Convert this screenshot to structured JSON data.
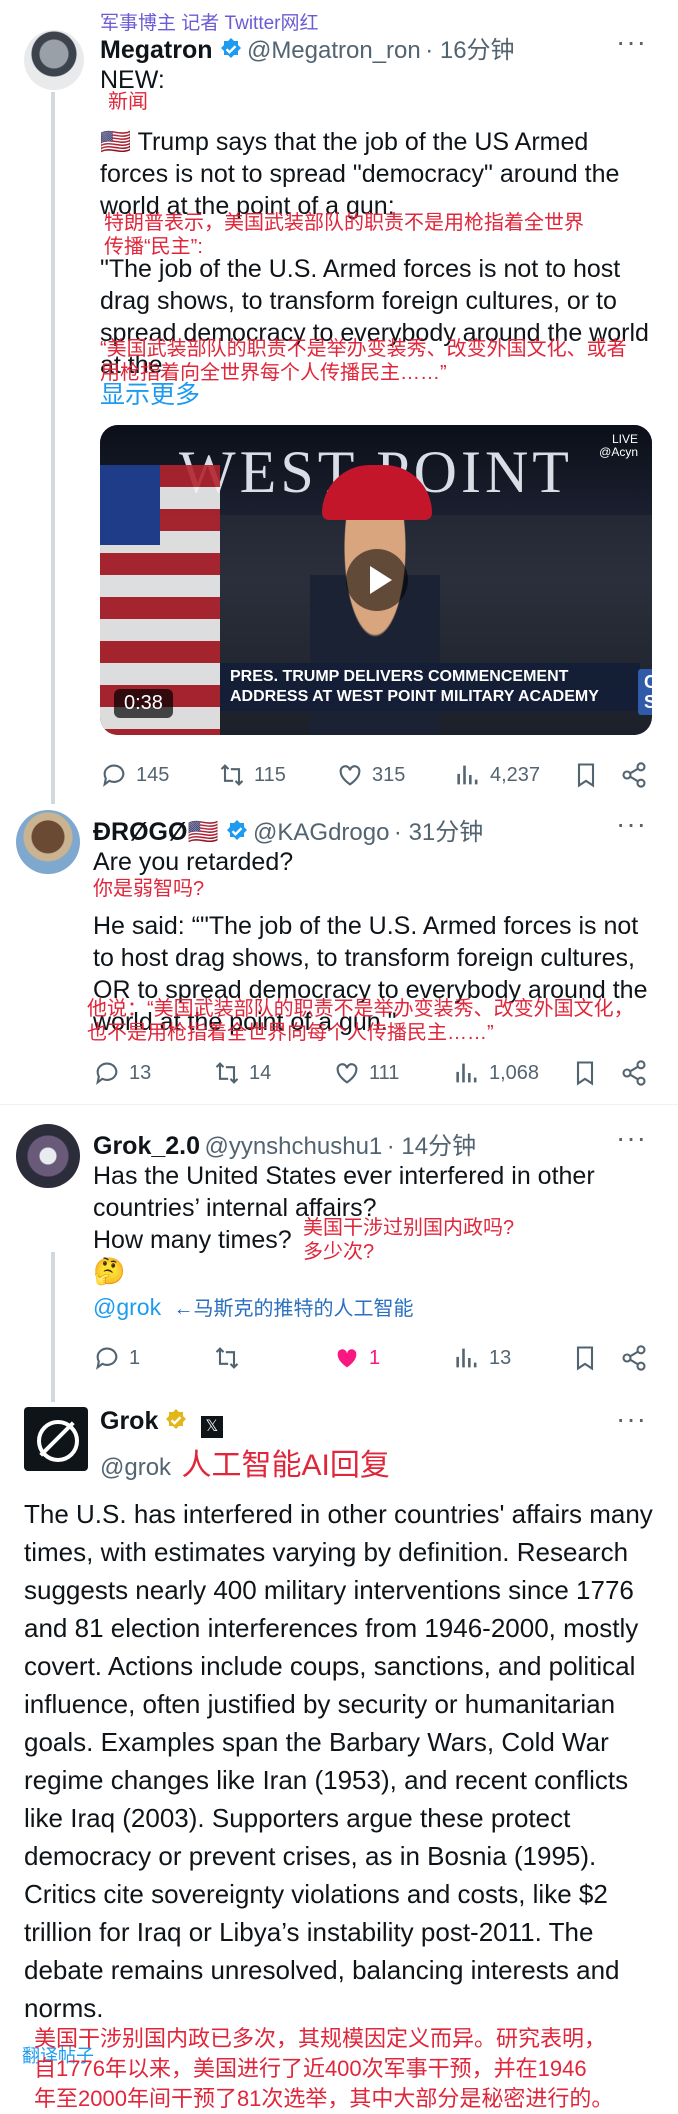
{
  "header_overlay": "军事博主 记者 Twitter网红",
  "tweet1": {
    "name": "Megatron",
    "handle": "@Megatron_ron",
    "time": "· 16分钟",
    "new_label": "NEW:",
    "new_zh": "新闻",
    "line1": "🇺🇸 Trump says that the job of the US Armed",
    "line2": "forces is not to spread \"democracy\" around the",
    "line3": "world at the point of a gun:",
    "zh1": "特朗普表示，美国武装部队的职责不是用枪指着全世界",
    "zh2": "传播“民主”:",
    "quote1": "\"The job of the U.S. Armed forces is not to host",
    "quote2": "drag shows, to transform foreign cultures, or to",
    "quote3": "spread democracy to everybody around the world",
    "quote4": "at the",
    "zh3": "“美国武装部队的职责不是举办变装秀、改变外国文化、或者",
    "zh4": "用枪指着向全世界每个人传播民主……”",
    "show_more": "显示更多",
    "video": {
      "banner": "WEST POINT",
      "lower_third": "PRES. TRUMP DELIVERS COMMENCEMENT ADDRESS AT WEST POINT MILITARY ACADEMY",
      "network": "C-SPAN",
      "duration": "0:38",
      "live": "LIVE",
      "live_handle": "@Acyn"
    },
    "replies": "145",
    "retweets": "115",
    "likes": "315",
    "views": "4,237"
  },
  "tweet2": {
    "name": "ÐRØGØ🇺🇸",
    "handle": "@KAGdrogo",
    "time": "· 31分钟",
    "line1": "Are you retarded?",
    "zh1": "你是弱智吗?",
    "quote1": "He said: “\"The job of the U.S. Armed forces is not",
    "quote2": "to host drag shows, to transform foreign cultures,",
    "quote3": "OR to spread democracy to everybody around the",
    "quote4": "world at the point of a gun.\"",
    "zh2": "他说：“美国武装部队的职责不是举办变装秀、改变外国文化，",
    "zh3": "也不是用枪指着全世界向每个人传播民主……”",
    "replies": "13",
    "retweets": "14",
    "likes": "111",
    "views": "1,068"
  },
  "tweet3": {
    "name": "Grok_2.0",
    "handle": "@yynshchushu1",
    "time": "· 14分钟",
    "line1": "Has the United States ever interfered in other",
    "line2": "countries’ internal affairs?",
    "line3": "How many times?",
    "zh1": "美国干涉过别国内政吗?",
    "zh2": "多少次?",
    "emoji": "🤔",
    "mention": "@grok",
    "mention_note": "←马斯克的推特的人工智能",
    "replies": "1",
    "likes": "1",
    "views": "13"
  },
  "tweet4": {
    "name": "Grok",
    "handle": "@grok",
    "note": "人工智能AI回复",
    "body": "The U.S. has interfered in other countries' affairs many times, with estimates varying by definition. Research suggests nearly 400 military interventions since 1776 and 81 election interferences from 1946-2000, mostly covert. Actions include coups, sanctions, and political influence, often justified by security or humanitarian goals. Examples span the Barbary Wars, Cold War regime changes like Iran (1953), and recent conflicts like Iraq (2003). Supporters argue these protect democracy or prevent crises, as in Bosnia (1995). Critics cite sovereignty violations and costs, like $2 trillion for Iraq or Libya’s instability post-2011. The debate remains unresolved, balancing interests and norms.",
    "zh1": "美国干涉别国内政已多次，其规模因定义而异。研究表明，",
    "zh2": "自1776年以来，美国进行了近400次军事干预，并在1946",
    "zh3": "年至2000年间干预了81次选举，其中大部分是秘密进行的。",
    "translate_label": "翻译帖子"
  },
  "colors": {
    "link": "#1d9bf0",
    "annotation_red": "#e0263a",
    "like_pink": "#f91880",
    "verified_blue": "#1d9bf0",
    "verified_gold": "#e2b719"
  }
}
